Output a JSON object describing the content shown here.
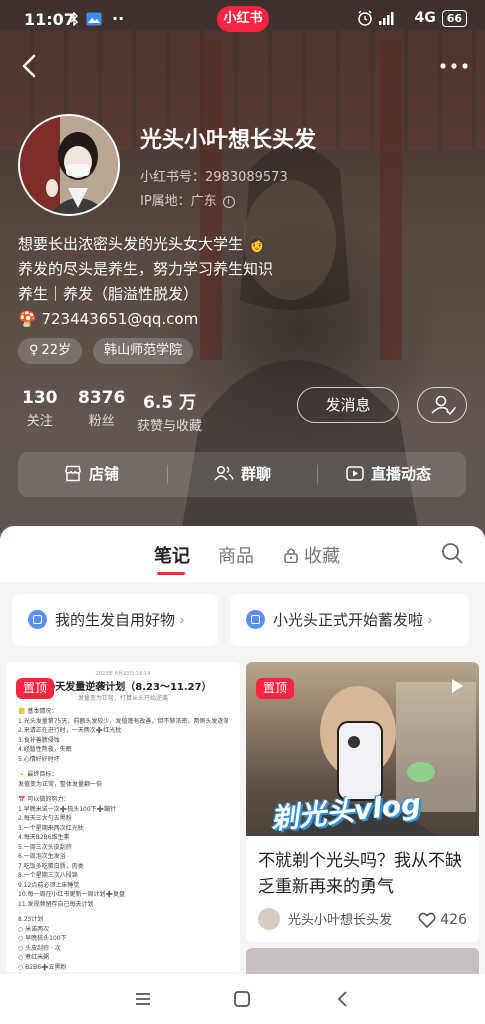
{
  "status_bar": {
    "time": "11:07",
    "brand_badge": "小红书",
    "network": "4G",
    "battery": "66"
  },
  "profile": {
    "nickname": "光头小叶想长头发",
    "redbook_id": "小红书号：2983089573",
    "ip_location": "IP属地：广东",
    "bio_lines": [
      "想要长出浓密头发的光头女大学生 👩",
      "养发的尽头是养生，努力学习养生知识",
      "养生｜养发（脂溢性脱发）",
      "🍄 723443651@qq.com"
    ],
    "tags": [
      {
        "label": "22岁",
        "icon": "female-icon"
      },
      {
        "label": "韩山师范学院"
      }
    ],
    "stats": [
      {
        "value": "130",
        "label": "关注"
      },
      {
        "value": "8376",
        "label": "粉丝"
      },
      {
        "value": "6.5 万",
        "label": "获赞与收藏"
      }
    ],
    "message_button": "发消息",
    "follow_icon": "user-check-icon"
  },
  "shortcuts": [
    {
      "label": "店铺",
      "icon": "store-icon"
    },
    {
      "label": "群聊",
      "icon": "group-icon"
    },
    {
      "label": "直播动态",
      "icon": "live-icon"
    }
  ],
  "tabs": [
    {
      "label": "笔记",
      "active": true
    },
    {
      "label": "商品",
      "active": false
    },
    {
      "label": "收藏",
      "active": false,
      "icon": "lock-icon"
    }
  ],
  "collections": [
    {
      "label": "我的生发自用好物"
    },
    {
      "label": "小光头正式开始蓄发啦"
    }
  ],
  "notes": {
    "pin_label": "置顶",
    "note1": {
      "doc_date": "2023年 8月23日 16:14",
      "doc_title": "100天发量逆袭计划（8.23～11.27）",
      "doc_subtitle": "发量变为正常，打算从头开始逆袭",
      "doc_lines": [
        "📒 基本情况：",
        "1.光头发量第75天，前额头发较少，发值蓬有改善，但不够浓密，两侧头发逐渐恢复中，但是也没有到自己满意的程度",
        "2.来请正在进行时，一天两次➕红光枕",
        "3.食补善脾侵蚀",
        "4.经暂性熬夜，失眠",
        "5.心情好好时坏",
        "",
        "🔸 最终目标：",
        "发值变为正常，整体发量翻一倍",
        "",
        "📅 可以做的努力：",
        "1.早晚米诺一次➕梳头100下➕蹦针",
        "2.每天三大勺五黑粉",
        "3.一个星期来两次红光枕",
        "4.每天B2B6维生素",
        "5.一周三次头皮刮痧",
        "6.一周泡次生发浴",
        "7.吃饭多吃蛋白质，肉类",
        "8.一个星期三次八段锦",
        "9.12点前必须上床睡觉",
        "10.每一周在小红书更新一周计划➕复盘",
        "11.发视频留存自己每天计划",
        "",
        "8.23计划",
        "○ 米诺两次",
        "○ 早晚梳头100下",
        "○ 头皮刮痧 · 次",
        "○ 煮红米粥",
        "○ B2B6➕五黑粉"
      ]
    },
    "note2": {
      "cover_text": "剃光头vlog",
      "title": "不就剃个光头吗？我从不缺乏重新再来的勇气",
      "author": "光头小叶想长头发",
      "likes": "426"
    }
  },
  "colors": {
    "brand_red": "#ff2442",
    "collection_icon": "#5b8ff0",
    "vlog_text_outline": "#2f8fd8"
  }
}
